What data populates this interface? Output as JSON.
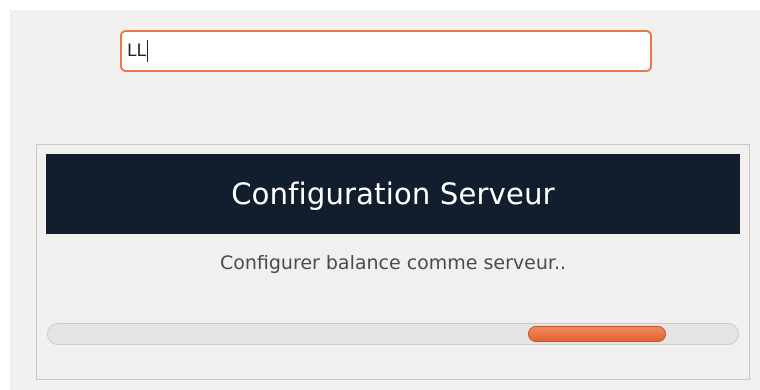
{
  "search": {
    "value": "LL"
  },
  "dialog": {
    "title": "Configuration Serveur",
    "message": "Configurer balance comme serveur..",
    "progress": {
      "mode": "indeterminate",
      "indicator_start_fraction": 0.695,
      "indicator_width_fraction": 0.2,
      "color": "#e8703f"
    }
  },
  "colors": {
    "accent": "#e8774a",
    "header_bg": "#121e2e",
    "window_bg": "#f2f0ee"
  }
}
